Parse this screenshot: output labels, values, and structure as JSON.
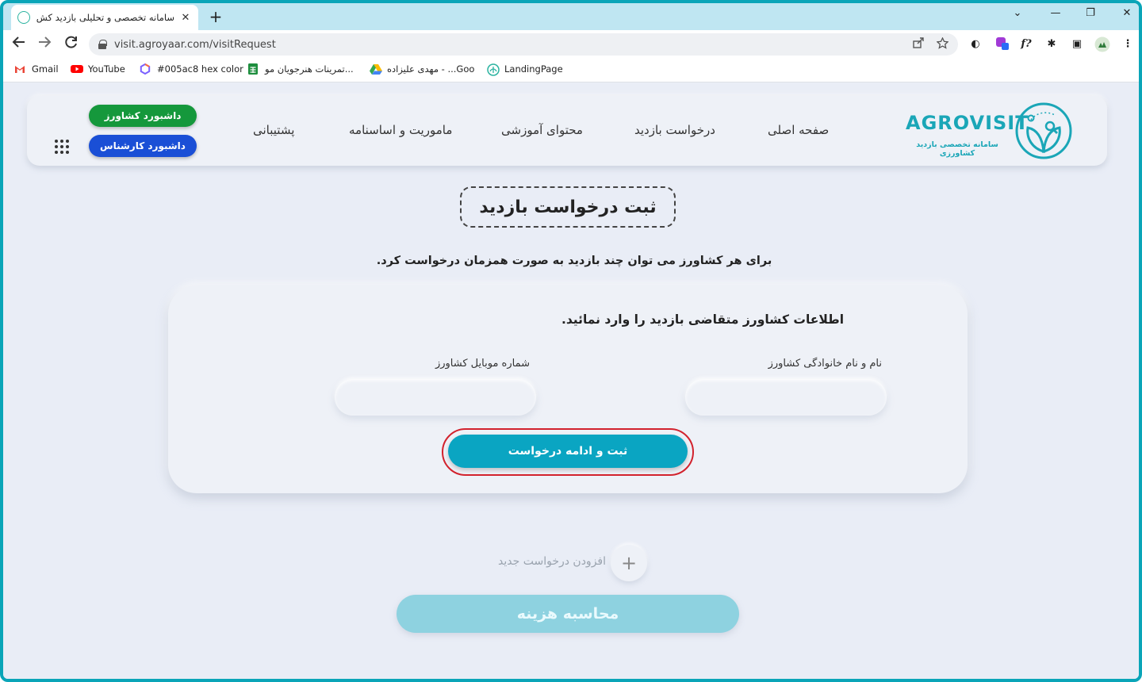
{
  "browser": {
    "tab_title": "سامانه تخصصی و تحلیلی بازدید کش...",
    "tab_close": "✕",
    "new_tab": "+",
    "url": "visit.agroyaar.com/visitRequest",
    "window_controls": {
      "collapse": "⌄",
      "minimize": "—",
      "restore": "❐",
      "close": "✕"
    },
    "extensions": {
      "ext1": "◐",
      "ext2": "f?",
      "ext3": "✱",
      "ext4": "▣",
      "menu": "⋮"
    }
  },
  "bookmarks": [
    {
      "label": "Gmail",
      "color": "#ea4335"
    },
    {
      "label": "YouTube",
      "color": "#ff0000"
    },
    {
      "label": "#005ac8 hex color",
      "color": "#7b61ff"
    },
    {
      "label": "تمرینات هنرجویان مو...",
      "color": "#1e8e3e"
    },
    {
      "label": "مهدی علیزاده - ...Goo",
      "color": "#fbbc04"
    },
    {
      "label": "LandingPage",
      "color": "#2bb3a0"
    }
  ],
  "header": {
    "logo_text": "AGROVISIT",
    "logo_subtitle": "سامانه تخصصی بازدید کشاورزی",
    "nav": {
      "home": "صفحه اصلی",
      "visit_request": "درخواست بازدید",
      "education": "محتوای آموزشی",
      "mission": "ماموریت و اساسنامه",
      "support": "پشتیبانی"
    },
    "farmer_dashboard": "داشبورد کشاورز",
    "expert_dashboard": "داشبورد کارشناس"
  },
  "main": {
    "page_title": "ثبت درخواست بازدید",
    "subtitle": "برای هر کشاورز می توان چند بازدید به صورت همزمان درخواست کرد.",
    "form": {
      "heading": "اطلاعات کشاورز متقاضی بازدید را وارد نمائید.",
      "name_label": "نام و نام خانوادگی کشاورز",
      "name_value": "",
      "mobile_label": "شماره موبایل کشاورز",
      "mobile_value": "",
      "submit_label": "ثبت و ادامه درخواست"
    },
    "add_request_label": "افزودن درخواست جدید",
    "add_request_icon": "+",
    "calc_cost_label": "محاسبه هزینه"
  },
  "colors": {
    "frame": "#0aa5b8",
    "accent": "#0aa5c2",
    "farmer_green": "#15983c",
    "expert_blue": "#1a4fd6",
    "highlight_ring": "#d2222d"
  }
}
